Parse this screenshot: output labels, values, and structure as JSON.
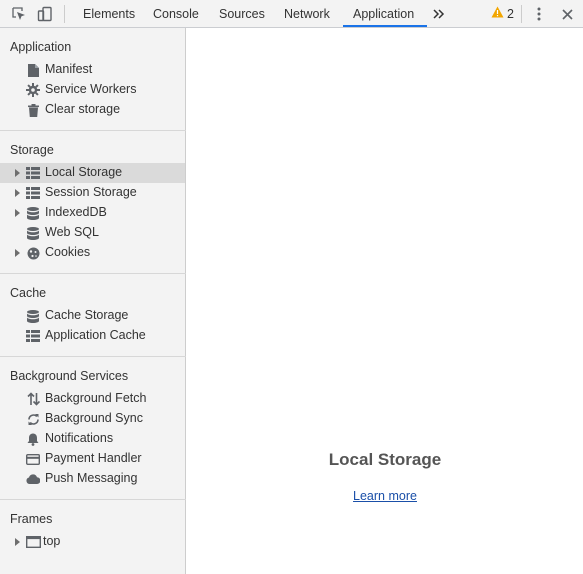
{
  "toolbar": {
    "inspect_icon": "inspect-element-icon",
    "device_icon": "device-toggle-icon",
    "tabs": [
      {
        "label": "Elements"
      },
      {
        "label": "Console"
      },
      {
        "label": "Sources"
      },
      {
        "label": "Network"
      },
      {
        "label": "Application"
      }
    ],
    "active_tab": "Application",
    "more_tabs_icon": "chevron-double-right-icon",
    "warning_count": "2",
    "menu_icon": "kebab-menu-icon",
    "close_icon": "close-icon",
    "accent_color": "#1a73e8",
    "warning_color": "#f2a600"
  },
  "sidebar": {
    "sections": [
      {
        "title": "Application",
        "items": [
          {
            "label": "Manifest",
            "icon": "document-icon"
          },
          {
            "label": "Service Workers",
            "icon": "gear-icon"
          },
          {
            "label": "Clear storage",
            "icon": "trash-icon"
          }
        ]
      },
      {
        "title": "Storage",
        "items": [
          {
            "label": "Local Storage",
            "icon": "table-icon",
            "expandable": true,
            "selected": true
          },
          {
            "label": "Session Storage",
            "icon": "table-icon",
            "expandable": true
          },
          {
            "label": "IndexedDB",
            "icon": "database-icon",
            "expandable": true
          },
          {
            "label": "Web SQL",
            "icon": "database-icon"
          },
          {
            "label": "Cookies",
            "icon": "cookie-icon",
            "expandable": true
          }
        ]
      },
      {
        "title": "Cache",
        "items": [
          {
            "label": "Cache Storage",
            "icon": "database-icon"
          },
          {
            "label": "Application Cache",
            "icon": "table-icon"
          }
        ]
      },
      {
        "title": "Background Services",
        "items": [
          {
            "label": "Background Fetch",
            "icon": "up-down-arrows-icon"
          },
          {
            "label": "Background Sync",
            "icon": "sync-icon"
          },
          {
            "label": "Notifications",
            "icon": "bell-icon"
          },
          {
            "label": "Payment Handler",
            "icon": "credit-card-icon"
          },
          {
            "label": "Push Messaging",
            "icon": "cloud-icon"
          }
        ]
      },
      {
        "title": "Frames",
        "items": [
          {
            "label": "top",
            "icon": "frame-icon",
            "expandable": true
          }
        ]
      }
    ]
  },
  "main": {
    "title": "Local Storage",
    "learn_more": "Learn more"
  }
}
